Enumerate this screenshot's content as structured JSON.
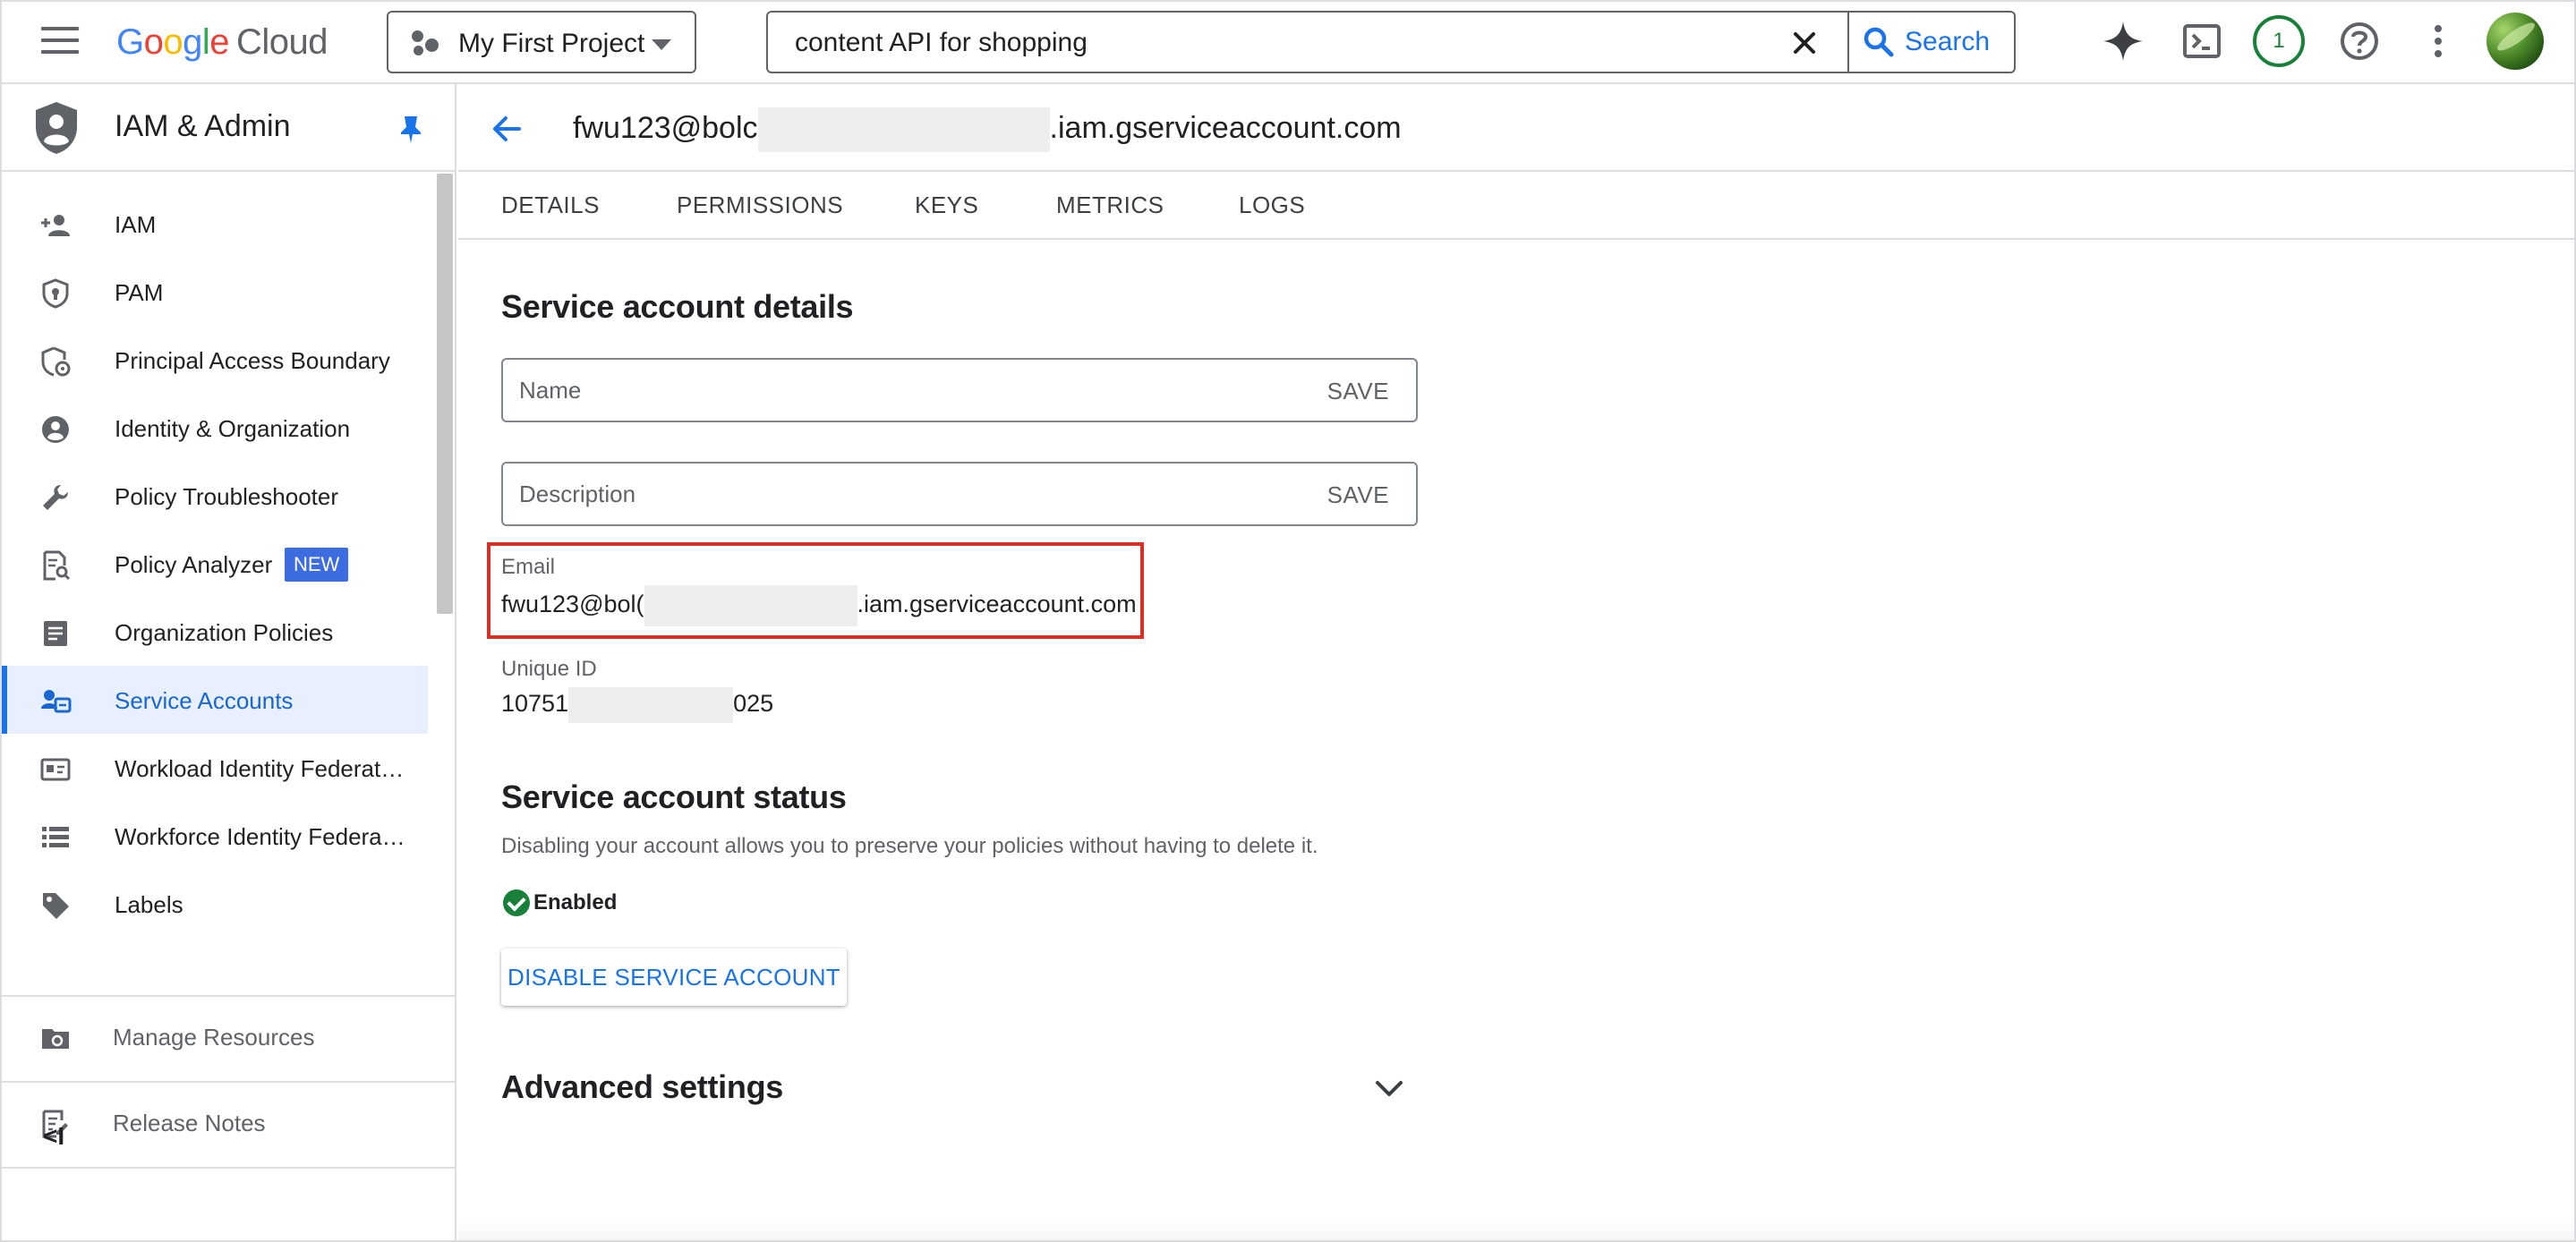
{
  "topbar": {
    "logo_google": [
      "G",
      "o",
      "o",
      "g",
      "l",
      "e"
    ],
    "logo_cloud": "Cloud",
    "project_name": "My First Project",
    "search_value": "content API for shopping",
    "search_button": "Search",
    "notification_count": "1"
  },
  "sidebar": {
    "title": "IAM & Admin",
    "items": [
      {
        "label": "IAM",
        "icon": "person-add-icon"
      },
      {
        "label": "PAM",
        "icon": "shield-lock-icon"
      },
      {
        "label": "Principal Access Boundary",
        "icon": "shield-settings-icon"
      },
      {
        "label": "Identity & Organization",
        "icon": "account-circle-icon"
      },
      {
        "label": "Policy Troubleshooter",
        "icon": "wrench-icon"
      },
      {
        "label": "Policy Analyzer",
        "icon": "document-search-icon",
        "badge": "NEW"
      },
      {
        "label": "Organization Policies",
        "icon": "list-document-icon"
      },
      {
        "label": "Service Accounts",
        "icon": "service-account-icon",
        "active": true
      },
      {
        "label": "Workload Identity Federat…",
        "icon": "id-card-icon"
      },
      {
        "label": "Workforce Identity Federa…",
        "icon": "list-icon"
      },
      {
        "label": "Labels",
        "icon": "tag-icon"
      }
    ],
    "footer": [
      {
        "label": "Manage Resources",
        "icon": "folder-settings-icon"
      },
      {
        "label": "Release Notes",
        "icon": "notes-icon"
      }
    ],
    "collapse_label": "<I"
  },
  "main": {
    "title_prefix": "fwu123@bolc",
    "title_suffix": ".iam.gserviceaccount.com",
    "tabs": [
      "DETAILS",
      "PERMISSIONS",
      "KEYS",
      "METRICS",
      "LOGS"
    ],
    "details": {
      "heading": "Service account details",
      "name_placeholder": "Name",
      "description_placeholder": "Description",
      "save_label": "SAVE",
      "email_label": "Email",
      "email_prefix": "fwu123@bol(",
      "email_suffix": ".iam.gserviceaccount.com",
      "unique_id_label": "Unique ID",
      "unique_id_prefix": "10751",
      "unique_id_suffix": "025"
    },
    "status": {
      "heading": "Service account status",
      "description": "Disabling your account allows you to preserve your policies without having to delete it.",
      "state": "Enabled",
      "state_color": "#188038",
      "disable_button": "DISABLE SERVICE ACCOUNT"
    },
    "advanced": {
      "heading": "Advanced settings"
    }
  },
  "colors": {
    "accent": "#1a73e8",
    "highlight_border": "#d93025",
    "new_badge": "#3c6ce0"
  }
}
